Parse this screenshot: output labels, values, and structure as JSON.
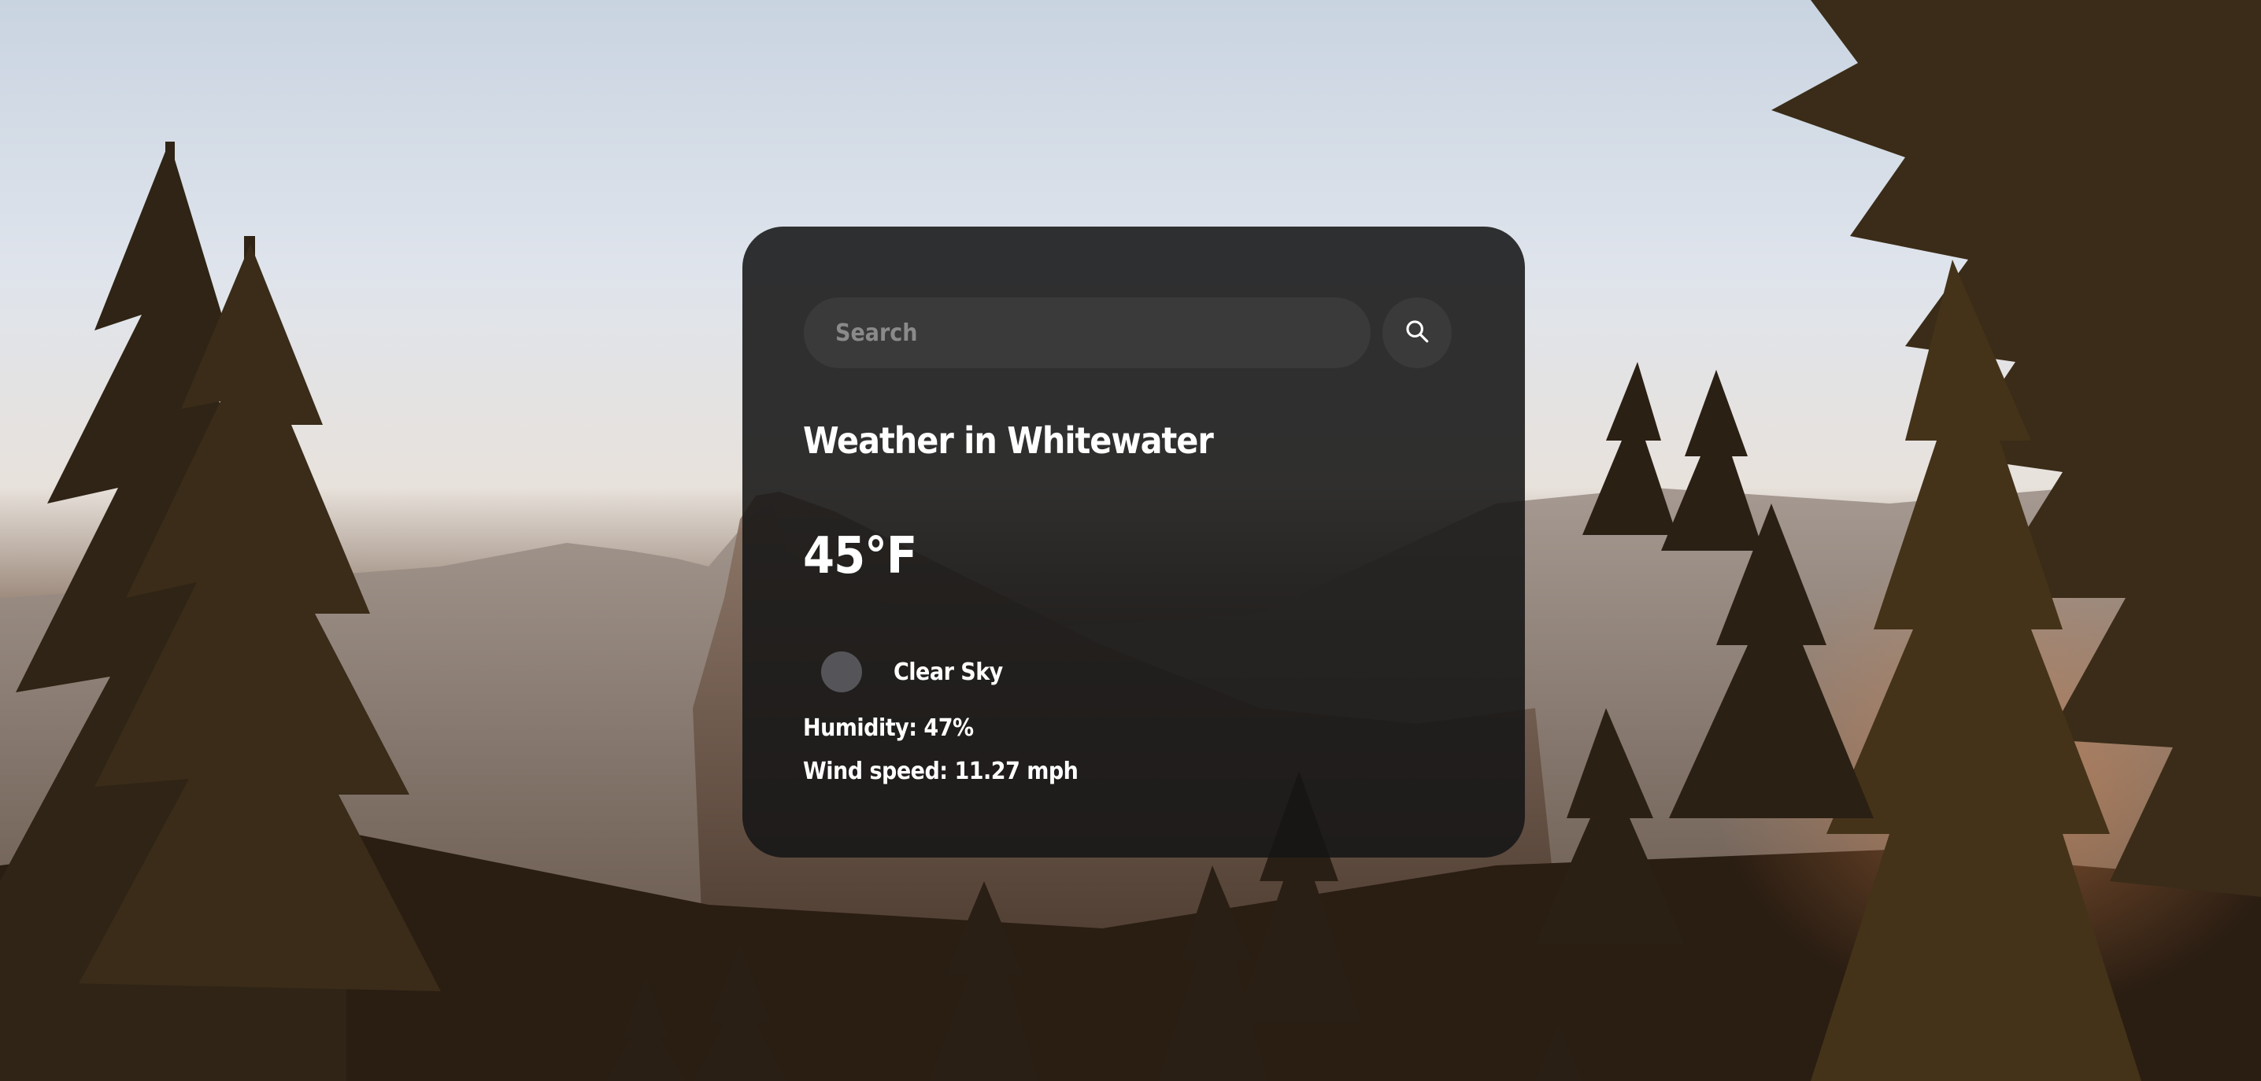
{
  "search": {
    "placeholder": "Search",
    "value": ""
  },
  "weather": {
    "title": "Weather in Whitewater",
    "temperature": "45°F",
    "condition": "Clear Sky",
    "humidity": "Humidity: 47%",
    "wind": "Wind speed: 11.27 mph"
  },
  "icons": {
    "search": "search-icon",
    "condition": "weather-condition-icon"
  },
  "colors": {
    "card_background": "#161616",
    "input_background": "#3a3a3a",
    "text": "#ffffff",
    "placeholder": "#8a8a8a"
  }
}
